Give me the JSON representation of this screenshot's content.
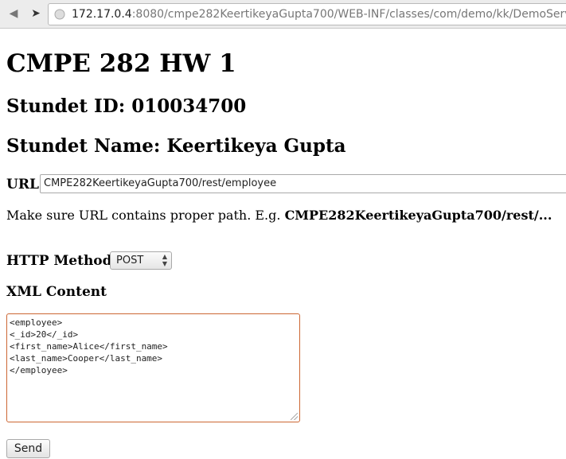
{
  "browser": {
    "url_host": "172.17.0.4",
    "url_rest": ":8080/cmpe282KeertikeyaGupta700/WEB-INF/classes/com/demo/kk/DemoServlet"
  },
  "page": {
    "title": "CMPE 282 HW 1",
    "student_id": "Stundet ID: 010034700",
    "student_name": "Stundet Name: Keertikeya Gupta"
  },
  "form": {
    "url_label": "URL",
    "url_value": "CMPE282KeertikeyaGupta700/rest/employee",
    "hint_prefix": "Make sure URL contains proper path. E.g. ",
    "hint_example": "CMPE282KeertikeyaGupta700/rest/...",
    "method_label": "HTTP Method",
    "method_value": "POST",
    "xml_label": "XML Content",
    "xml_lines": [
      "<employee>",
      "<_id>20</_id>",
      "<first_name>Alice</first_name>",
      "<last_name>Cooper</last_name>",
      "</employee>"
    ],
    "send_label": "Send"
  }
}
